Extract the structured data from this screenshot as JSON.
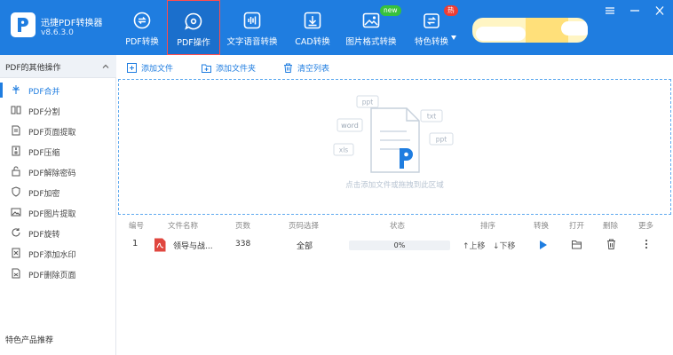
{
  "app": {
    "name": "迅捷PDF转换器",
    "version": "v8.6.3.0"
  },
  "nav": {
    "items": [
      {
        "label": "PDF转换",
        "icon": "convert-icon"
      },
      {
        "label": "PDF操作",
        "icon": "gear-bubble-icon",
        "active": true
      },
      {
        "label": "文字语音转换",
        "icon": "audio-wave-icon"
      },
      {
        "label": "CAD转换",
        "icon": "cad-download-icon"
      },
      {
        "label": "图片格式转换",
        "icon": "image-icon",
        "badge": "new"
      },
      {
        "label": "特色转换",
        "icon": "special-convert-icon",
        "badge": "热"
      }
    ]
  },
  "sidebar": {
    "header": "PDF的其他操作",
    "items": [
      {
        "label": "PDF合并",
        "icon": "merge-icon",
        "active": true
      },
      {
        "label": "PDF分割",
        "icon": "split-icon"
      },
      {
        "label": "PDF页面提取",
        "icon": "page-extract-icon"
      },
      {
        "label": "PDF压缩",
        "icon": "compress-icon"
      },
      {
        "label": "PDF解除密码",
        "icon": "unlock-icon"
      },
      {
        "label": "PDF加密",
        "icon": "shield-icon"
      },
      {
        "label": "PDF图片提取",
        "icon": "image-extract-icon"
      },
      {
        "label": "PDF旋转",
        "icon": "rotate-icon"
      },
      {
        "label": "PDF添加水印",
        "icon": "watermark-icon"
      },
      {
        "label": "PDF删除页面",
        "icon": "delete-page-icon"
      }
    ],
    "footer": "特色产品推荐"
  },
  "toolbar": {
    "add_file": "添加文件",
    "add_folder": "添加文件夹",
    "clear_list": "清空列表"
  },
  "dropzone": {
    "tags": [
      "word",
      "xls",
      "txt",
      "ppt",
      "ppt"
    ],
    "hint": "点击添加文件或拖拽到此区域"
  },
  "table": {
    "headers": [
      "编号",
      "文件名称",
      "页数",
      "页码选择",
      "状态",
      "排序",
      "转换",
      "打开",
      "删除",
      "更多"
    ],
    "rows": [
      {
        "index": "1",
        "filename": "领导与战...",
        "pages": "338",
        "page_select": "全部",
        "status": "0%",
        "progress": 0,
        "sort_up": "↑上移",
        "sort_down": "↓下移"
      }
    ]
  },
  "colors": {
    "accent": "#1f7de0",
    "active_border": "#ff4d4d",
    "badge_new": "#37c13d",
    "badge_hot": "#ee3d33",
    "pdf_red": "#e0473f"
  }
}
